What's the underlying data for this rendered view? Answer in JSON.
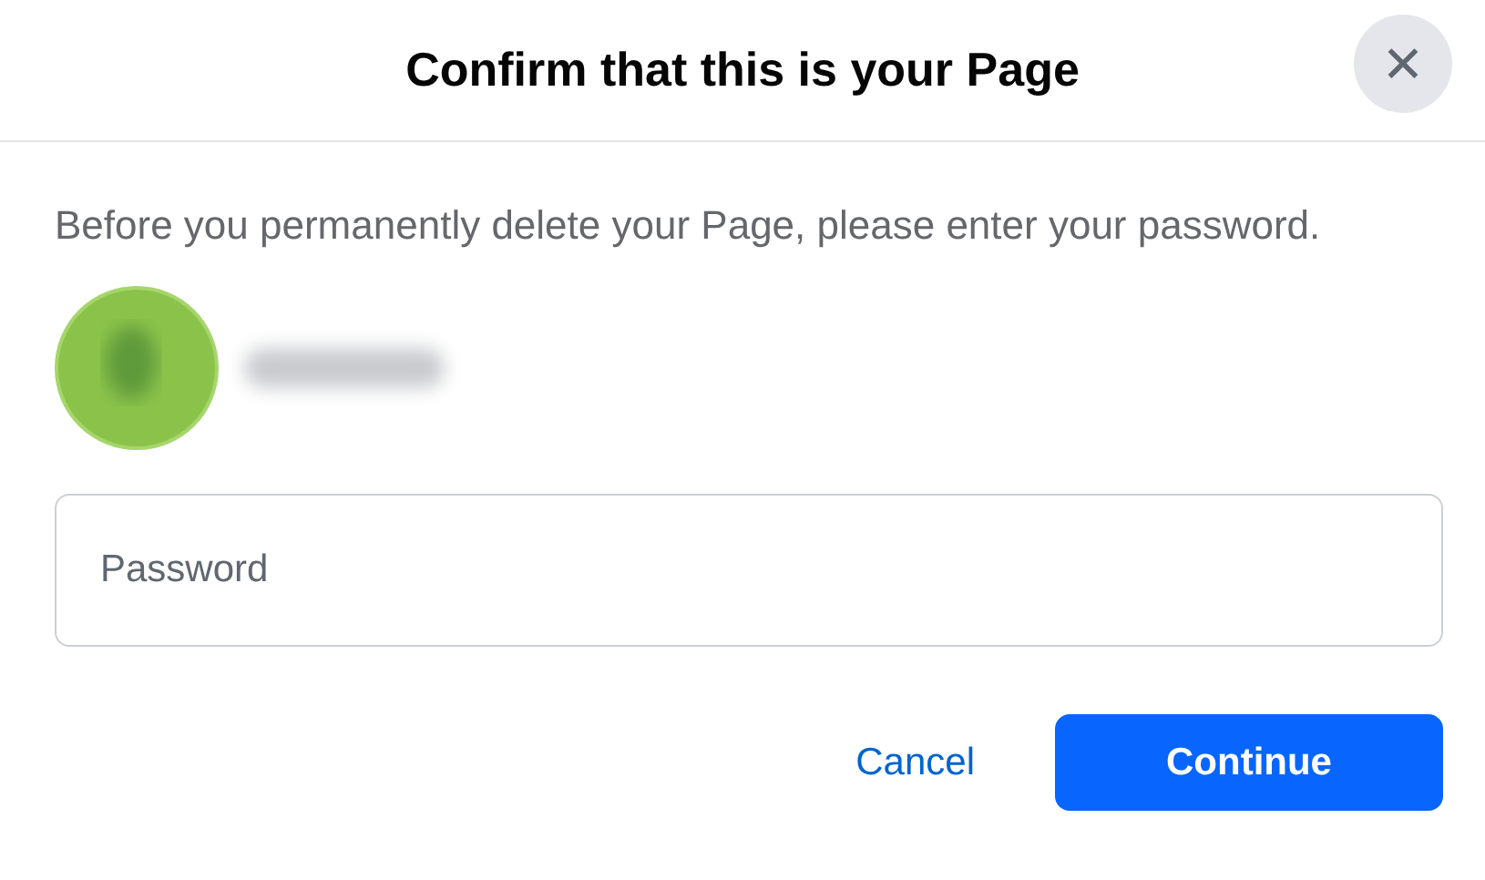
{
  "dialog": {
    "title": "Confirm that this is your Page",
    "close_label": "✕"
  },
  "message": "Before you permanently delete your Page, please enter your password.",
  "password_field": {
    "placeholder": "Password"
  },
  "buttons": [
    {
      "label": "Cancel",
      "kind": "link"
    },
    {
      "label": "Continue",
      "kind": "primary"
    }
  ]
}
